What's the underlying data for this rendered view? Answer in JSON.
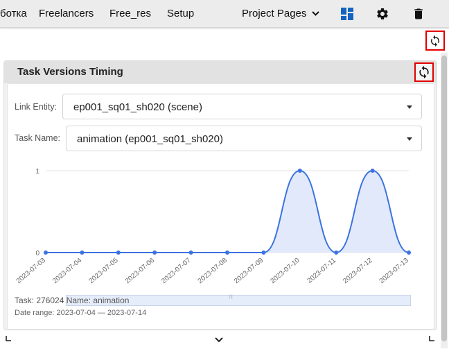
{
  "topbar": {
    "items": [
      {
        "label": "ботка"
      },
      {
        "label": "Freelancers"
      },
      {
        "label": "Free_res"
      },
      {
        "label": "Setup"
      }
    ],
    "project_pages_label": "Project Pages",
    "icons": [
      "dashboard-icon",
      "gear-icon",
      "trash-icon"
    ]
  },
  "widget": {
    "title": "Task Versions Timing",
    "link_entity_label": "Link Entity:",
    "link_entity_value": "ep001_sq01_sh020 (scene)",
    "task_name_label": "Task Name:",
    "task_name_value": "animation (ep001_sq01_sh020)",
    "task_info": "Task: 276024 Name: animation",
    "date_range": "Date range: 2023-07-04 — 2023-07-14"
  },
  "colors": {
    "accent": "#1565c0",
    "series_line": "#3b73e0",
    "series_fill": "#dfe7fa",
    "highlight_border": "#e30000"
  },
  "chart_data": {
    "type": "area",
    "x": [
      "2023-07-03",
      "2023-07-04",
      "2023-07-05",
      "2023-07-06",
      "2023-07-07",
      "2023-07-08",
      "2023-07-09",
      "2023-07-10",
      "2023-07-11",
      "2023-07-12",
      "2023-07-13"
    ],
    "y": [
      0,
      0,
      0,
      0,
      0,
      0,
      0,
      1,
      0,
      1,
      0
    ],
    "yticks": [
      0,
      1
    ],
    "ylim": [
      0,
      1
    ],
    "grid": true,
    "smooth": true
  }
}
